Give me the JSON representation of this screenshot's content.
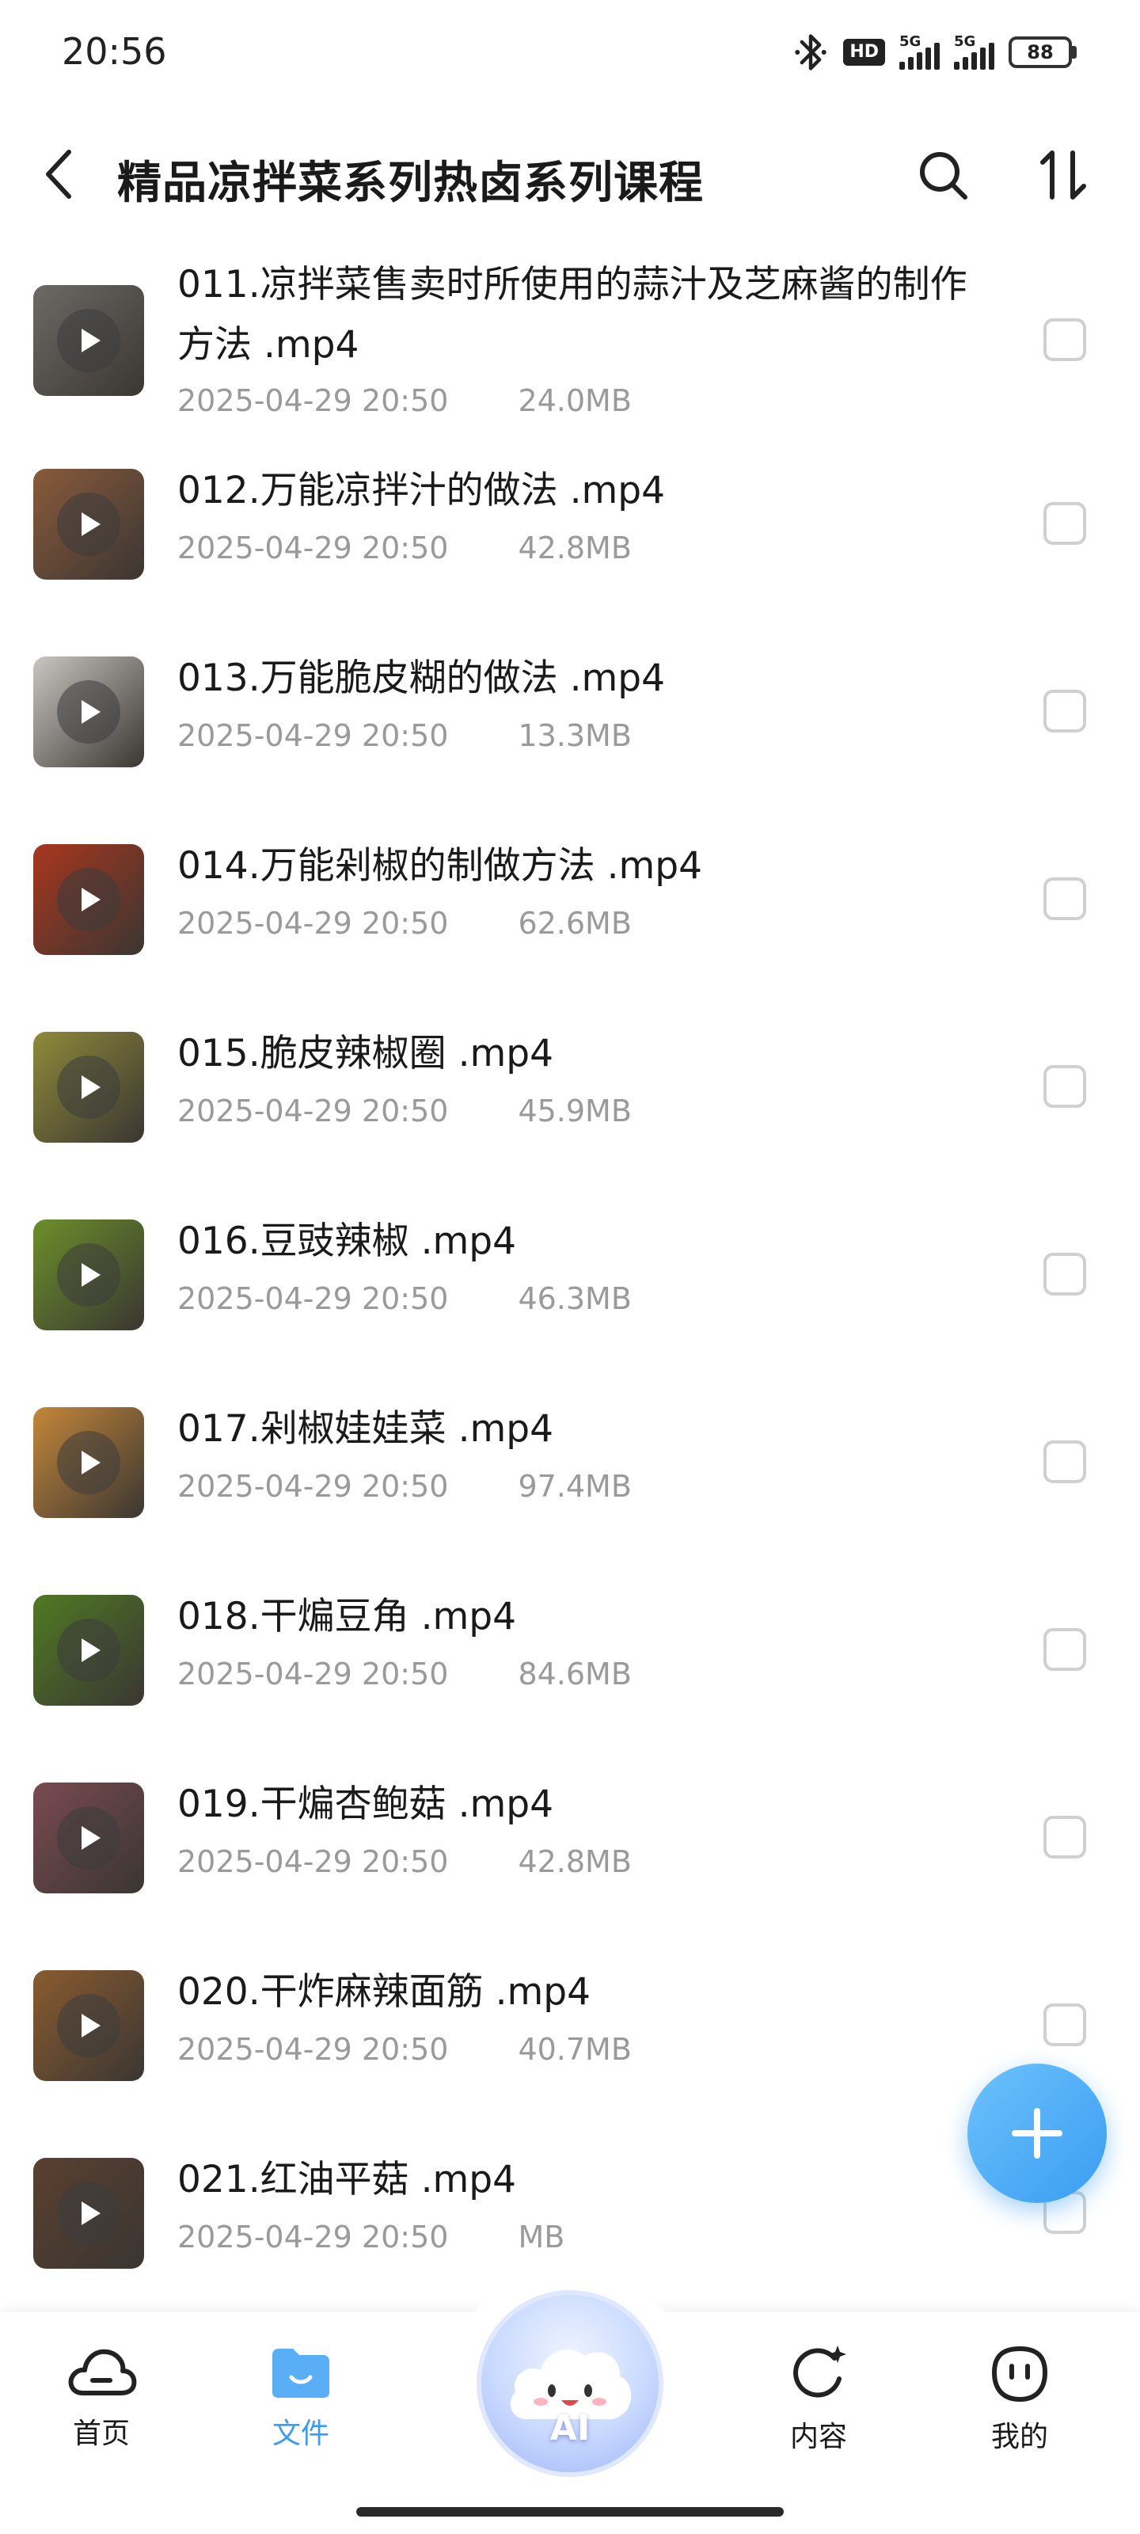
{
  "status_bar": {
    "time": "20:56",
    "hd_label": "HD",
    "net1": "5G",
    "net2": "5G",
    "battery": "88"
  },
  "header": {
    "title": "精品凉拌菜系列热卤系列课程",
    "back_icon": "chevron-left-icon",
    "search_icon": "search-icon",
    "sort_icon": "sort-icon"
  },
  "files": [
    {
      "name": "011.凉拌菜售卖时所使用的蒜汁及芝麻酱的制作方法 .mp4",
      "date": "2025-04-29 20:50",
      "size": "24.0MB",
      "thumb": "#6d6a66"
    },
    {
      "name": "012.万能凉拌汁的做法 .mp4",
      "date": "2025-04-29 20:50",
      "size": "42.8MB",
      "thumb": "#8a5a3c"
    },
    {
      "name": "013.万能脆皮糊的做法 .mp4",
      "date": "2025-04-29 20:50",
      "size": "13.3MB",
      "thumb": "#c9c6c1"
    },
    {
      "name": "014.万能剁椒的制做方法 .mp4",
      "date": "2025-04-29 20:50",
      "size": "62.6MB",
      "thumb": "#a8361e"
    },
    {
      "name": "015.脆皮辣椒圈 .mp4",
      "date": "2025-04-29 20:50",
      "size": "45.9MB",
      "thumb": "#8f8a3a"
    },
    {
      "name": "016.豆豉辣椒 .mp4",
      "date": "2025-04-29 20:50",
      "size": "46.3MB",
      "thumb": "#6b8f2a"
    },
    {
      "name": "017.剁椒娃娃菜 .mp4",
      "date": "2025-04-29 20:50",
      "size": "97.4MB",
      "thumb": "#c4873a"
    },
    {
      "name": "018.干煸豆角 .mp4",
      "date": "2025-04-29 20:50",
      "size": "84.6MB",
      "thumb": "#4f7a24"
    },
    {
      "name": "019.干煸杏鲍菇 .mp4",
      "date": "2025-04-29 20:50",
      "size": "42.8MB",
      "thumb": "#7a4a52"
    },
    {
      "name": "020.干炸麻辣面筋 .mp4",
      "date": "2025-04-29 20:50",
      "size": "40.7MB",
      "thumb": "#8a5b30"
    },
    {
      "name": "021.红油平菇 .mp4",
      "date": "2025-04-29 20:50",
      "size": "MB",
      "thumb": "#5a4030"
    }
  ],
  "fab": {
    "icon": "plus-icon"
  },
  "nav": {
    "home": "首页",
    "files": "文件",
    "ai": "AI",
    "content": "内容",
    "mine": "我的"
  },
  "colors": {
    "accent": "#3a9cf2",
    "meta_text": "#9a9a9a",
    "title_text": "#1a1a1a"
  }
}
